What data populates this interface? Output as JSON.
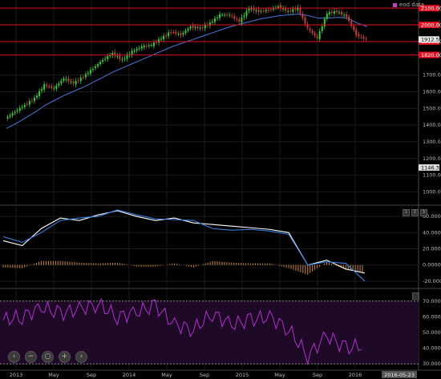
{
  "legend": {
    "label": "eod data",
    "color": "#c040c0"
  },
  "x_axis": {
    "labels": [
      "2013",
      "May",
      "Sep",
      "2014",
      "May",
      "Sep",
      "2015",
      "May",
      "Sep",
      "2016"
    ],
    "last_date": "2016-05-23"
  },
  "price_pane": {
    "tick_labels": [
      "1700.00",
      "1600.00",
      "1500.00",
      "1400.00",
      "1300.00",
      "1200.00",
      "1100.00",
      "1000.00"
    ],
    "hlines": [
      {
        "label": "2100.00",
        "value": 2100
      },
      {
        "label": "2000.00",
        "value": 2000
      },
      {
        "label": "1900.00",
        "value": 1900
      },
      {
        "label": "1820.00",
        "value": 1820
      }
    ],
    "current_label": "1912.53",
    "cursor_label": "1146.35"
  },
  "macd_pane": {
    "tick_labels": [
      "60.0000",
      "40.0000",
      "20.0000",
      "0.0000",
      "-20.0000"
    ],
    "buttons": [
      "1",
      "2",
      "3"
    ]
  },
  "rsi_pane": {
    "tick_labels": [
      "70.0000",
      "60.0000",
      "50.0000",
      "40.0000",
      "30.0000"
    ]
  },
  "controls": [
    "‹",
    "−",
    "○",
    "+",
    "›"
  ],
  "colors": {
    "background": "#000000",
    "bull": "#3cc83c",
    "bear": "#c83c3c",
    "ma_line": "#4a78d8",
    "hline": "#e01020",
    "macd_fast": "#ffffff",
    "macd_slow": "#3a80e0",
    "macd_hist": "#d08a40",
    "rsi_line": "#b030d0",
    "rsi_bg": "#1e0a26"
  },
  "chart_data": [
    {
      "type": "candlestick",
      "title": "",
      "x": [
        "2013-01",
        "2013-02",
        "2013-03",
        "2013-04",
        "2013-05",
        "2013-06",
        "2013-07",
        "2013-08",
        "2013-09",
        "2013-10",
        "2013-11",
        "2013-12",
        "2014-01",
        "2014-02",
        "2014-03",
        "2014-04",
        "2014-05",
        "2014-06",
        "2014-07",
        "2014-08",
        "2014-09",
        "2014-10",
        "2014-11",
        "2014-12",
        "2015-01",
        "2015-02",
        "2015-03",
        "2015-04",
        "2015-05",
        "2015-06",
        "2015-07",
        "2015-08",
        "2015-09",
        "2015-10",
        "2015-11",
        "2015-12",
        "2016-01",
        "2016-02"
      ],
      "close": [
        1440,
        1480,
        1520,
        1560,
        1640,
        1620,
        1680,
        1650,
        1690,
        1740,
        1790,
        1830,
        1790,
        1840,
        1870,
        1880,
        1920,
        1960,
        1940,
        1990,
        1980,
        2010,
        2060,
        2060,
        2020,
        2100,
        2080,
        2090,
        2110,
        2080,
        2100,
        1980,
        1920,
        2070,
        2080,
        2050,
        1940,
        1912
      ],
      "ma": [
        1380,
        1410,
        1445,
        1480,
        1520,
        1550,
        1580,
        1605,
        1630,
        1660,
        1690,
        1720,
        1745,
        1770,
        1795,
        1820,
        1845,
        1870,
        1890,
        1910,
        1930,
        1950,
        1970,
        1990,
        2005,
        2020,
        2035,
        2045,
        2055,
        2060,
        2065,
        2055,
        2040,
        2040,
        2045,
        2040,
        2010,
        1990
      ],
      "y_range": [
        950,
        2120
      ]
    },
    {
      "type": "line",
      "x": [
        "2013-01",
        "2013-03",
        "2013-05",
        "2013-07",
        "2013-09",
        "2013-11",
        "2014-01",
        "2014-03",
        "2014-05",
        "2014-07",
        "2014-09",
        "2014-11",
        "2015-01",
        "2015-03",
        "2015-05",
        "2015-07",
        "2015-09",
        "2015-11",
        "2016-01",
        "2016-02"
      ],
      "series": [
        {
          "values": [
            30,
            24,
            45,
            58,
            55,
            62,
            67,
            60,
            55,
            58,
            52,
            50,
            48,
            46,
            44,
            40,
            0,
            6,
            -5,
            -10
          ]
        },
        {
          "values": [
            35,
            28,
            40,
            55,
            58,
            60,
            68,
            62,
            57,
            56,
            55,
            45,
            43,
            44,
            42,
            38,
            0,
            4,
            2,
            -20
          ]
        }
      ],
      "histogram": [
        -3,
        -4,
        5,
        5,
        3,
        2,
        3,
        -2,
        -2,
        2,
        -3,
        5,
        3,
        2,
        2,
        -4,
        -12,
        4,
        -6,
        -9
      ],
      "y_range": [
        -25,
        68
      ]
    },
    {
      "type": "line",
      "x": [
        "2013-01",
        "2013-03",
        "2013-05",
        "2013-07",
        "2013-09",
        "2013-11",
        "2014-01",
        "2014-03",
        "2014-05",
        "2014-07",
        "2014-09",
        "2014-11",
        "2015-01",
        "2015-03",
        "2015-05",
        "2015-07",
        "2015-09",
        "2015-11",
        "2016-01",
        "2016-02"
      ],
      "series": [
        {
          "values": [
            58,
            60,
            66,
            62,
            65,
            68,
            60,
            63,
            67,
            55,
            52,
            62,
            55,
            58,
            60,
            52,
            35,
            48,
            40,
            42
          ]
        }
      ],
      "overbought": 70,
      "oversold": 30,
      "y_range": [
        28,
        75
      ]
    }
  ]
}
